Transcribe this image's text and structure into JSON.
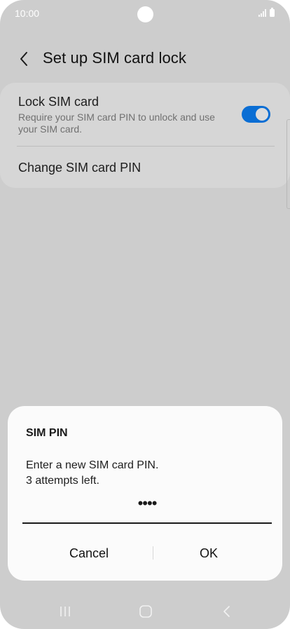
{
  "status_bar": {
    "time": "10:00"
  },
  "header": {
    "title": "Set up SIM card lock"
  },
  "settings": {
    "lock_sim": {
      "title": "Lock SIM card",
      "subtitle": "Require your SIM card PIN to unlock and use your SIM card.",
      "enabled": true
    },
    "change_pin": {
      "title": "Change SIM card PIN"
    }
  },
  "dialog": {
    "title": "SIM PIN",
    "message_line1": "Enter a new SIM card PIN.",
    "message_line2": "3 attempts left.",
    "pin_value": "••••",
    "cancel_label": "Cancel",
    "ok_label": "OK"
  },
  "nav_bar": {
    "icons": [
      "recents-icon",
      "home-icon",
      "back-icon"
    ]
  },
  "colors": {
    "accent": "#0a6ed4",
    "background": "#cdcdcd",
    "dialog": "#fbfbfb"
  }
}
